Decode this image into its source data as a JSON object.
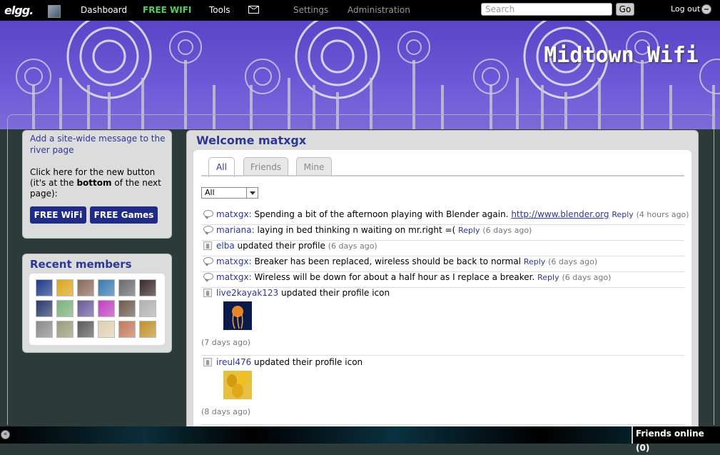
{
  "topbar": {
    "logo": "elgg.",
    "dashboard": "Dashboard",
    "free_wifi": "FREE WIFI",
    "tools": "Tools",
    "settings": "Settings",
    "administration": "Administration",
    "search_placeholder": "Search",
    "go": "Go",
    "logout": "Log out"
  },
  "header": {
    "site_title": "Midtown Wifi"
  },
  "sidebar": {
    "site_message_link": "Add a site-wide message to the river page",
    "new_button_text_1": "Click here for the new button (it's at the ",
    "new_button_text_bold": "bottom",
    "new_button_text_2": " of the next page):",
    "btn_free_wifi": "FREE WiFi",
    "btn_free_games": "FREE Games",
    "recent_members_title": "Recent members",
    "member_colors": [
      "#1f3a8a",
      "#d9a51a",
      "#8a6a5a",
      "#3a7ab0",
      "#6a6a70",
      "#3a2a2a",
      "#2a3a6a",
      "#7ab07a",
      "#6a5a9a",
      "#c040c0",
      "#6a5a4a",
      "#b0b0b0",
      "#8a8a8a",
      "#9a9a7a",
      "#5a5a5a",
      "#e0d0b0",
      "#c07a5a",
      "#c0902a"
    ]
  },
  "main": {
    "welcome": "Welcome matxgx",
    "tabs": [
      "All",
      "Friends",
      "Mine"
    ],
    "filter_value": "All",
    "river": [
      {
        "icon": "bubble",
        "user": "matxgx:",
        "text": " Spending a bit of the afternoon playing with Blender again. ",
        "link": "http://www.blender.org",
        "reply": "Reply",
        "time": "(4 hours ago)"
      },
      {
        "icon": "bubble",
        "user": "mariana:",
        "text": " laying in bed thinking n waiting on mr.right =( ",
        "reply": "Reply",
        "time": "(6 days ago)"
      },
      {
        "icon": "person",
        "user": "elba",
        "text": " updated their profile ",
        "time": "(6 days ago)"
      },
      {
        "icon": "bubble",
        "user": "matxgx:",
        "text": " Breaker has been replaced, wireless should be back to normal ",
        "reply": "Reply",
        "time": "(6 days ago)"
      },
      {
        "icon": "bubble",
        "user": "matxgx:",
        "text": " Wireless will be down for about a half hour as I replace a breaker. ",
        "reply": "Reply",
        "time": "(6 days ago)"
      },
      {
        "icon": "person",
        "user": "live2kayak123",
        "text": " updated their profile icon",
        "time": "(7 days ago)"
      },
      {
        "icon": "person",
        "user": "ireul476",
        "text": " updated their profile icon",
        "time": "(8 days ago)"
      }
    ]
  },
  "bottom": {
    "friends_online": "Friends online (0)",
    "collapse_glyph": "«"
  },
  "colors": {
    "brand_blue": "#2b3896",
    "button_blue": "#1f2b86",
    "header_purple": "#5a44c8",
    "wifi_green": "#4fd15f"
  }
}
